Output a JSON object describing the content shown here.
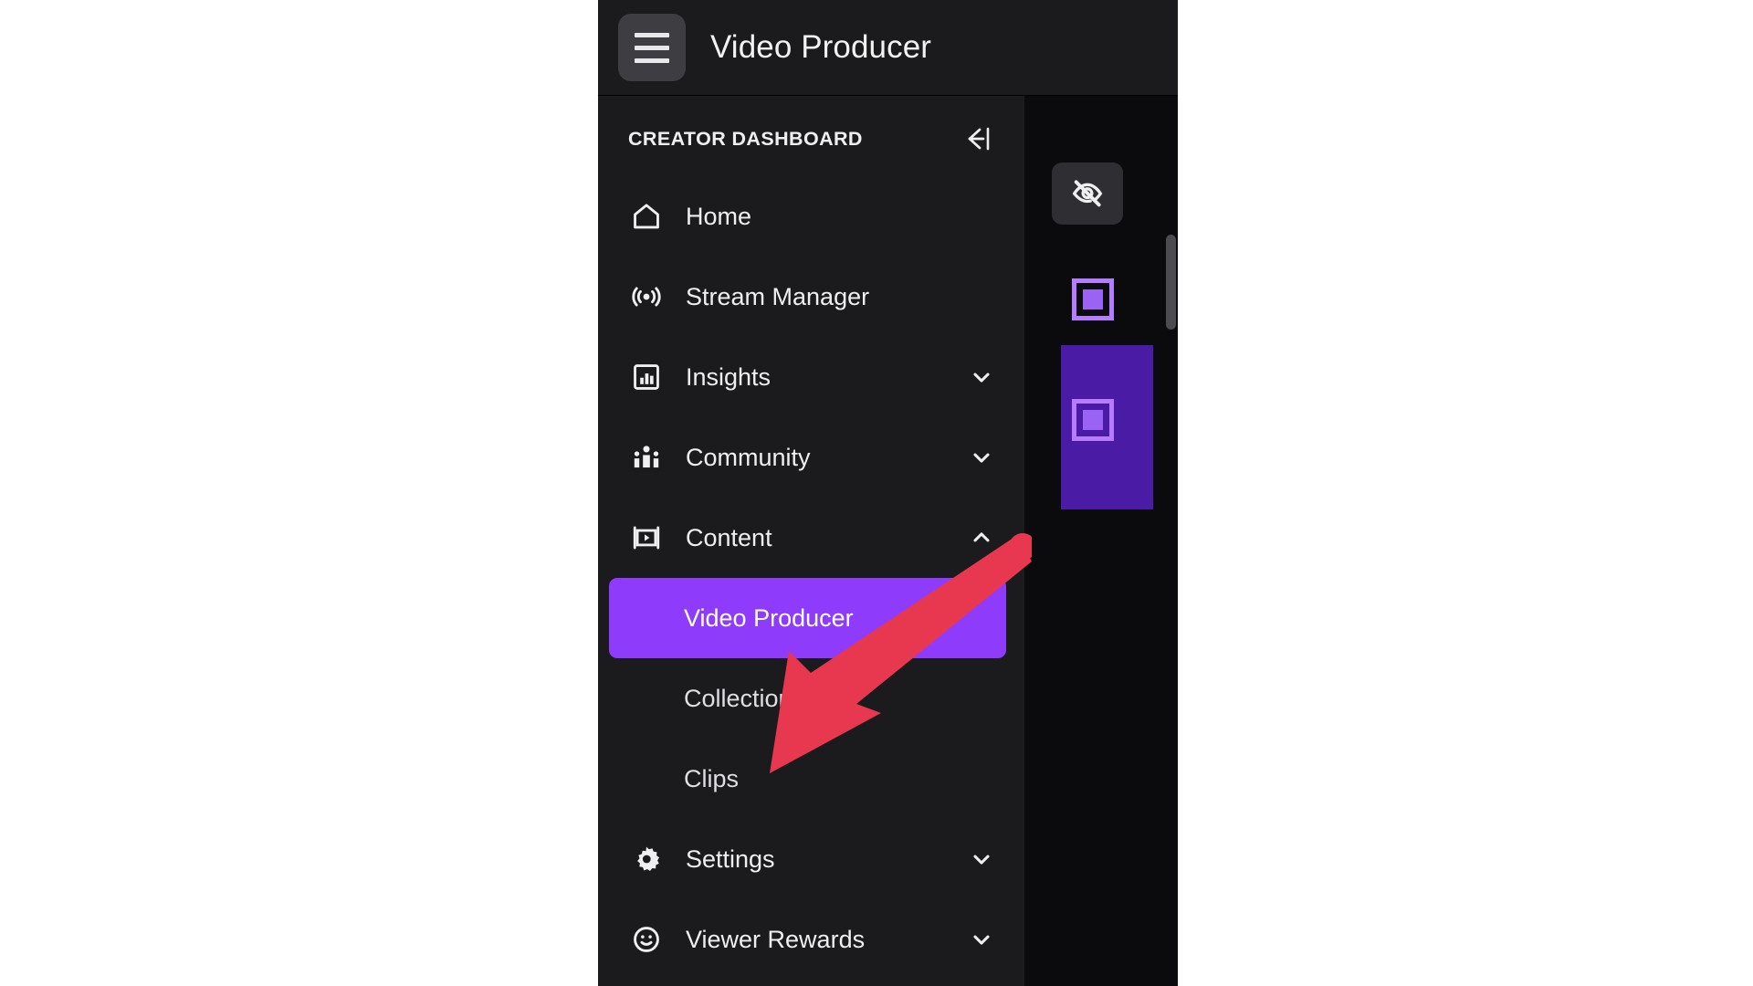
{
  "app": {
    "title": "Video Producer",
    "menu_icon": "hamburger-icon"
  },
  "sidebar": {
    "header_label": "CREATOR DASHBOARD",
    "collapse_icon": "collapse-sidebar-icon",
    "items": [
      {
        "label": "Home",
        "icon": "home-icon",
        "expandable": false,
        "chevron": ""
      },
      {
        "label": "Stream Manager",
        "icon": "broadcast-icon",
        "expandable": false,
        "chevron": ""
      },
      {
        "label": "Insights",
        "icon": "bar-chart-icon",
        "expandable": true,
        "chevron": "chevron-down-icon"
      },
      {
        "label": "Community",
        "icon": "people-icon",
        "expandable": true,
        "chevron": "chevron-down-icon"
      },
      {
        "label": "Content",
        "icon": "video-frame-icon",
        "expandable": true,
        "chevron": "chevron-up-icon"
      },
      {
        "label": "Settings",
        "icon": "gear-icon",
        "expandable": true,
        "chevron": "chevron-down-icon"
      },
      {
        "label": "Viewer Rewards",
        "icon": "smiley-icon",
        "expandable": true,
        "chevron": "chevron-down-icon"
      }
    ],
    "content_subitems": [
      {
        "label": "Video Producer",
        "active": true
      },
      {
        "label": "Collections",
        "active": false
      },
      {
        "label": "Clips",
        "active": false
      }
    ]
  },
  "content_panel": {
    "hide_button_icon": "eye-off-icon",
    "marker_icon": "purple-square-marker",
    "scrollbar": "vertical-scrollbar"
  },
  "annotation": {
    "type": "arrow",
    "direction": "down-left",
    "color": "#e8384f"
  },
  "colors": {
    "accent_purple": "#8e3bfb",
    "block_purple": "#4a1ca5",
    "marker_border": "#b57cff",
    "sidebar_bg": "#1b1b1e",
    "panel_bg": "#0b0b0d",
    "topbar_bg": "#1b1b1e",
    "text_primary": "#efeff1",
    "annotation_red": "#e8384f"
  }
}
